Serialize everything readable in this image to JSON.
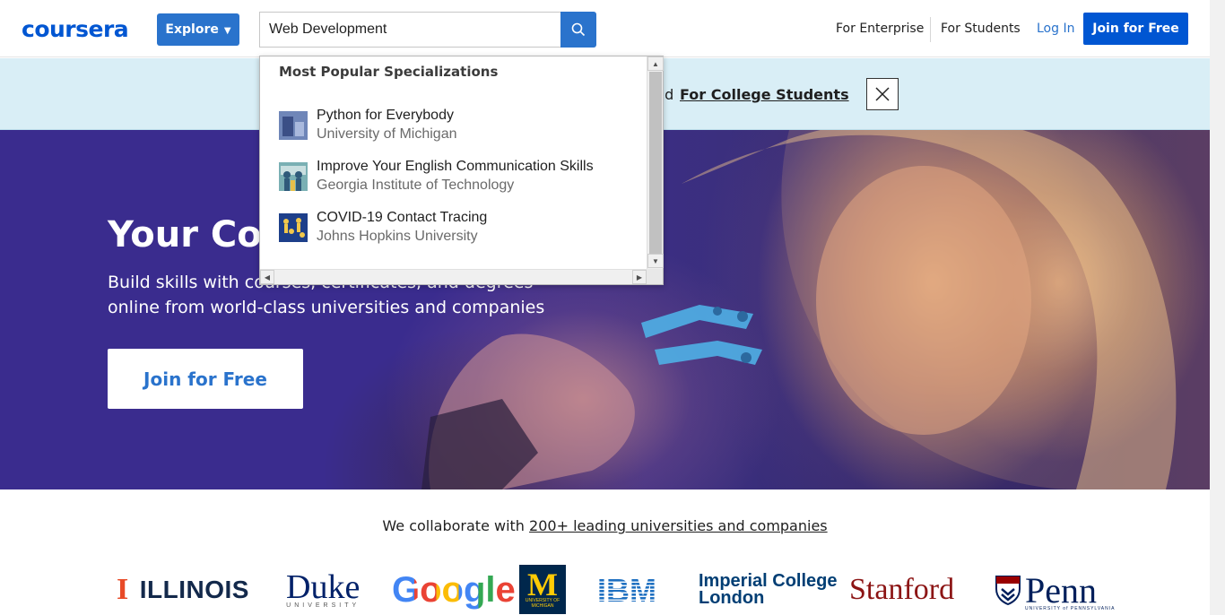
{
  "header": {
    "logo": "coursera",
    "explore_label": "Explore",
    "search_value": "Web Development",
    "search_icon": "search-icon",
    "nav": {
      "enterprise": "For Enterprise",
      "students": "For Students",
      "login": "Log In",
      "join": "Join for Free"
    }
  },
  "banner": {
    "text_fragment": "nd",
    "link": "For College Students",
    "close_icon": "close-icon"
  },
  "hero": {
    "title": "Your Cou",
    "subtitle_line1": "Build skills with courses, certificates, and degrees",
    "subtitle_line2": "online from world-class universities and companies",
    "join": "Join for Free"
  },
  "dropdown": {
    "heading": "Most Popular Specializations",
    "items": [
      {
        "title": "Python for Everybody",
        "subtitle": "University of Michigan"
      },
      {
        "title": "Improve Your English Communication Skills",
        "subtitle": "Georgia Institute of Technology"
      },
      {
        "title": "COVID-19 Contact Tracing",
        "subtitle": "Johns Hopkins University"
      }
    ]
  },
  "partners": {
    "collab_text": "We collaborate with",
    "collab_link": "200+ leading universities and companies",
    "logos": {
      "illinois": "ILLINOIS",
      "duke": "Duke",
      "duke_sub": "UNIVERSITY",
      "google": "Google",
      "michigan_m": "M",
      "michigan_sub": "UNIVERSITY OF MICHIGAN",
      "ibm": "IBM",
      "imperial_line1": "Imperial College",
      "imperial_line2": "London",
      "stanford": "Stanford",
      "penn": "Penn",
      "penn_sub": "UNIVERSITY of PENNSYLVANIA"
    }
  },
  "colors": {
    "brand_blue": "#0056d2",
    "accent_blue": "#2a73cc",
    "banner_bg": "#d9eef6",
    "hero_bg": "#3a2c8e"
  }
}
